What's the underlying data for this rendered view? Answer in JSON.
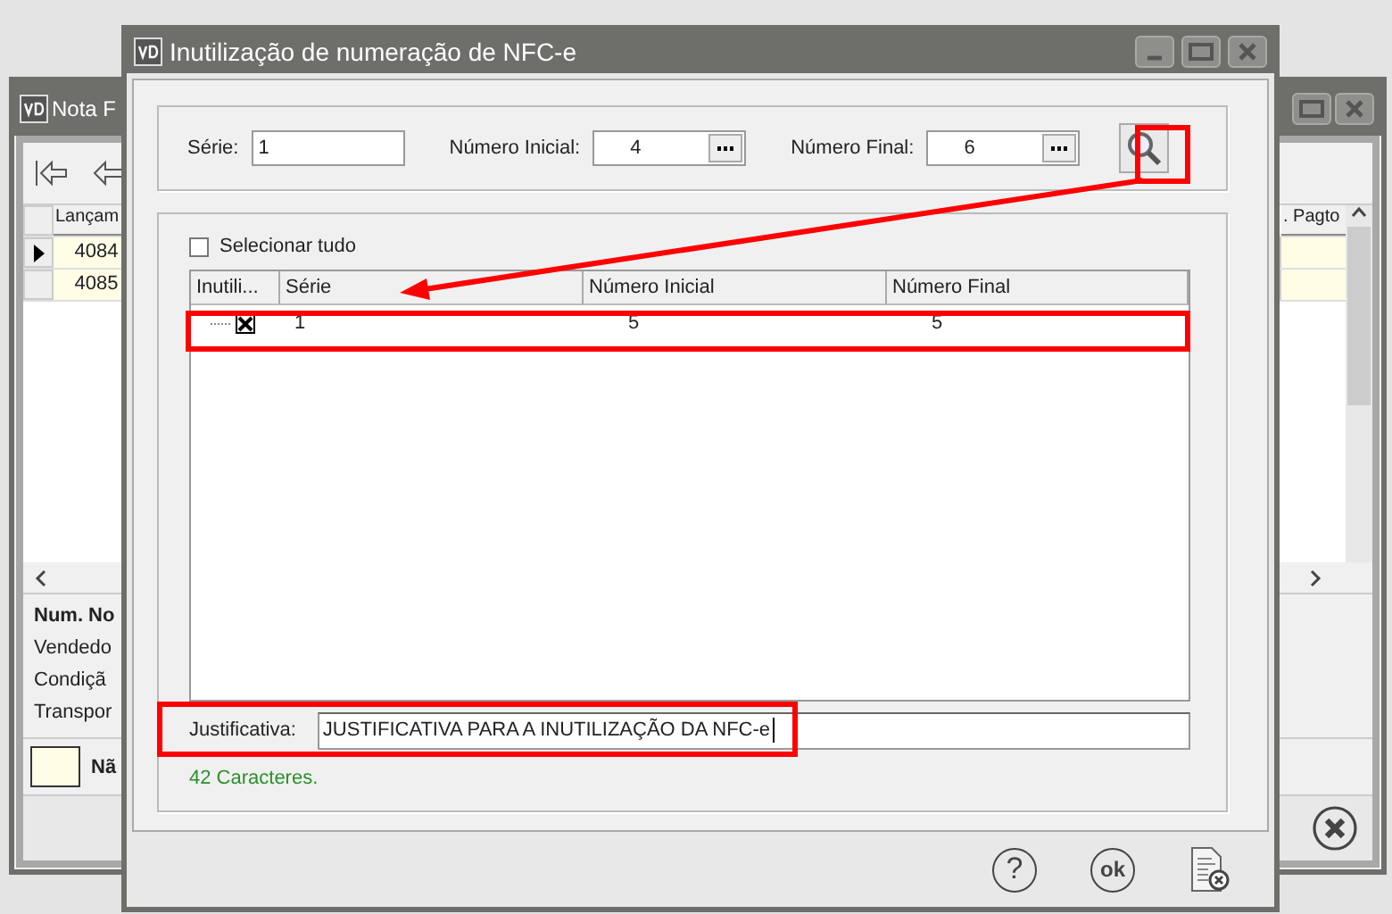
{
  "background_window": {
    "title": "Nota F",
    "grid": {
      "columns": [
        "Lançam",
        ". Pagto"
      ],
      "rows": [
        {
          "cell": "4084",
          "selected": true
        },
        {
          "cell": "4085",
          "selected": false
        }
      ]
    },
    "details": [
      {
        "text": "Num. No",
        "bold": true
      },
      {
        "text": "Vendedo",
        "bold": false
      },
      {
        "text": "Condiçã",
        "bold": false
      },
      {
        "text": "Transpor",
        "bold": false
      }
    ],
    "legend": "Nã"
  },
  "dialog": {
    "title": "Inutilização de numeração de NFC-e",
    "filters": [
      {
        "label": "Série:",
        "value": "1",
        "kind": "text"
      },
      {
        "label": "Número Inicial:",
        "value": "4",
        "kind": "lookup"
      },
      {
        "label": "Número Final:",
        "value": "6",
        "kind": "lookup"
      }
    ],
    "select_all": {
      "label": "Selecionar tudo",
      "checked": false
    },
    "table": {
      "columns": [
        "Inutili...",
        "Série",
        "Número Inicial",
        "Número Final"
      ],
      "rows": [
        {
          "checked": true,
          "serie": "1",
          "numero_inicial": "5",
          "numero_final": "5"
        }
      ]
    },
    "justificativa": {
      "label": "Justificativa:",
      "value": "JUSTIFICATIVA PARA A INUTILIZAÇÃO DA NFC-e"
    },
    "char_count": "42 Caracteres.",
    "footer_buttons": [
      {
        "kind": "help",
        "label": "?"
      },
      {
        "kind": "ok",
        "label": "ok"
      },
      {
        "kind": "cancel"
      }
    ]
  }
}
